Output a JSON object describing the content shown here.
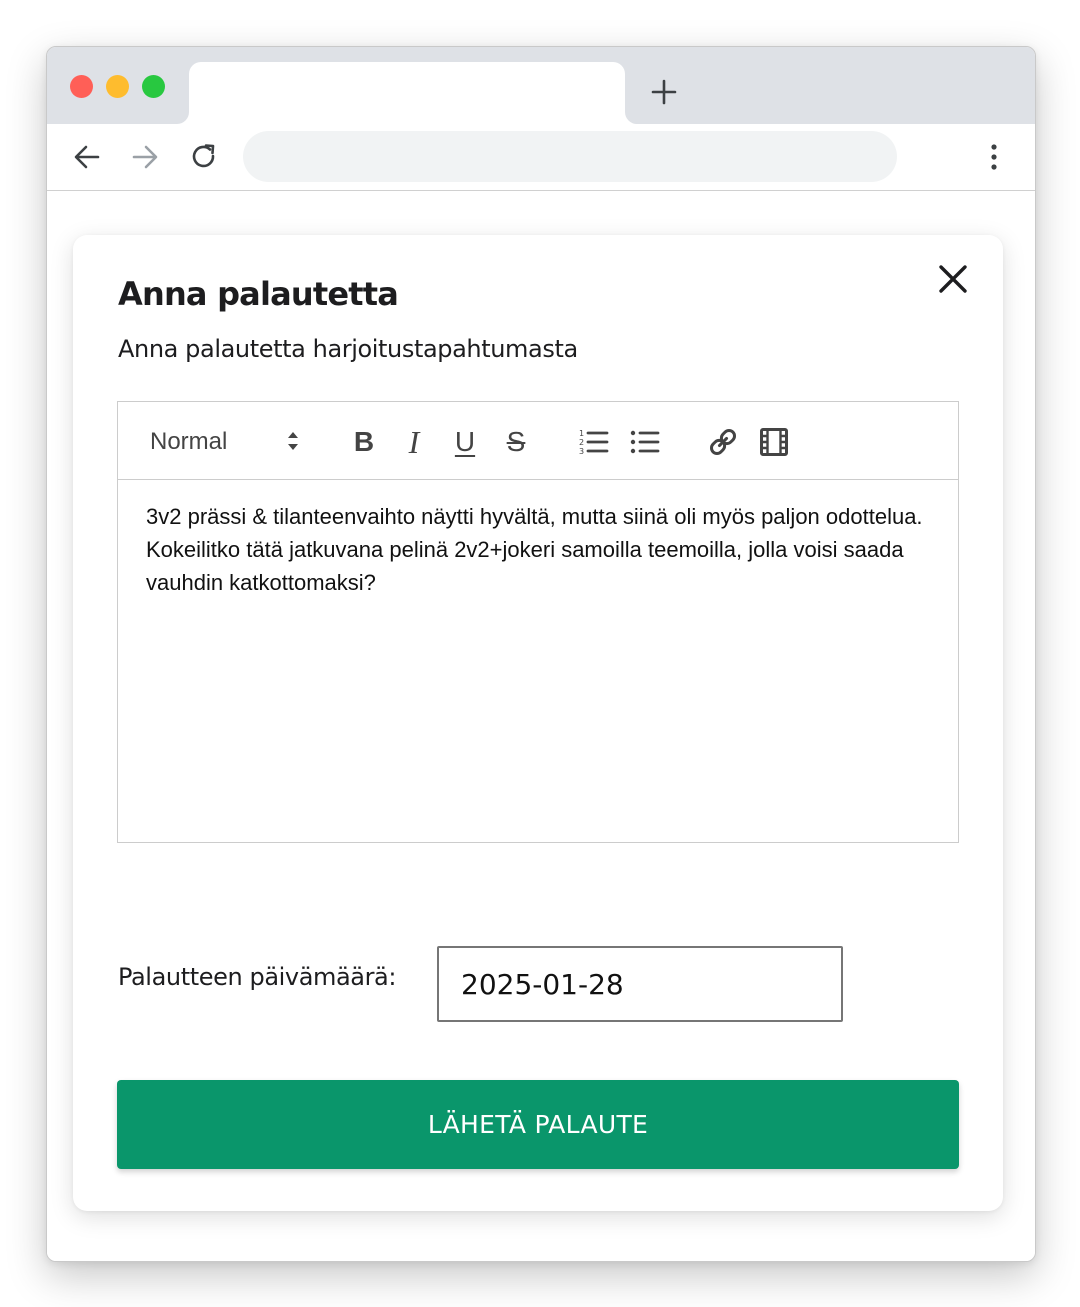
{
  "browser": {
    "tab_title": "",
    "address": "",
    "new_tab_label": "+"
  },
  "modal": {
    "title": "Anna palautetta",
    "subtitle": "Anna palautetta harjoitustapahtumasta"
  },
  "editor": {
    "format": "Normal",
    "content": "3v2 prässi & tilanteenvaihto näytti hyvältä, mutta siinä oli myös paljon odottelua. Kokeilitko tätä jatkuvana pelinä 2v2+jokeri samoilla teemoilla, jolla voisi saada vauhdin katkottomaksi?",
    "toolbar_glyphs": {
      "bold": "B",
      "italic": "I",
      "underline": "U",
      "strike": "S"
    }
  },
  "date": {
    "label": "Palautteen päivämäärä:",
    "value": "2025-01-28"
  },
  "submit": {
    "label": "LÄHETÄ PALAUTE"
  },
  "colors": {
    "accent": "#0a966b",
    "text": "#1d1d1f",
    "toolbar_icon": "#444444"
  },
  "icons": {
    "close": "close-icon",
    "back": "arrow-left-icon",
    "forward": "arrow-right-icon",
    "reload": "reload-icon",
    "menu": "kebab-menu-icon",
    "ordered_list": "ordered-list-icon",
    "bullet_list": "bullet-list-icon",
    "link": "link-icon",
    "video": "video-icon"
  }
}
